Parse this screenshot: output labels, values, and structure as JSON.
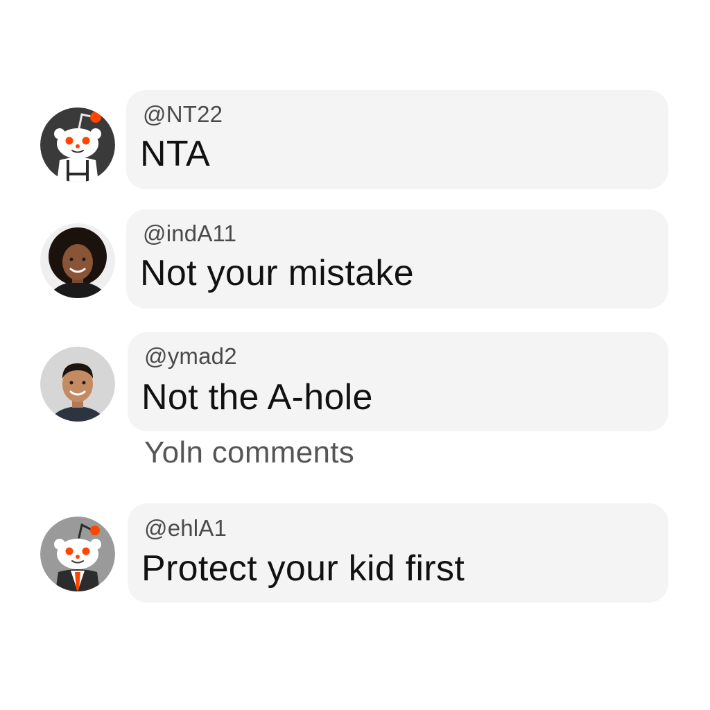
{
  "comments": [
    {
      "username": "@NT22",
      "text": "NTA",
      "avatar": "reddit-snoo-dark-icon"
    },
    {
      "username": "@indA11",
      "text": "Not your mistake",
      "avatar": "user-photo-woman"
    },
    {
      "username": "@ymad2",
      "text": "Not the A-hole",
      "avatar": "user-photo-man"
    },
    {
      "username": "@ehlA1",
      "text": "Protect your kid first",
      "avatar": "reddit-snoo-tie-icon"
    }
  ],
  "join_label": "Yoln comments",
  "colors": {
    "bubble": "#f4f4f4",
    "username": "#4a4a4a",
    "text": "#111111",
    "accent_orange": "#ff4500"
  }
}
